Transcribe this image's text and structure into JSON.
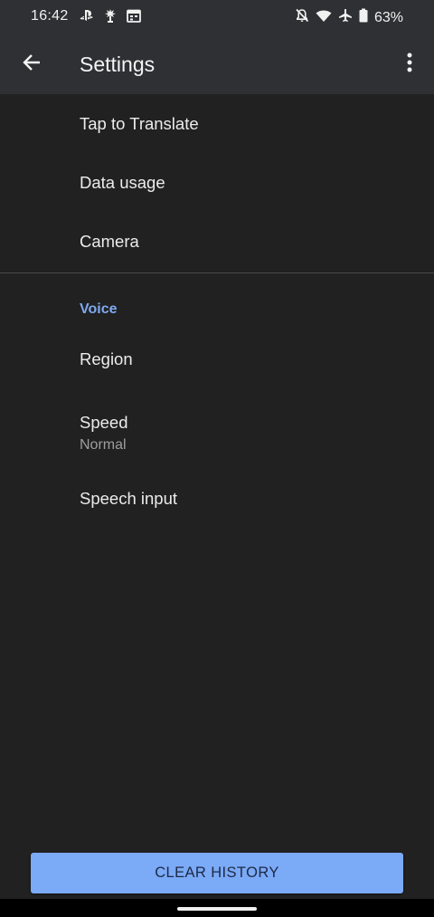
{
  "status_bar": {
    "time": "16:42",
    "battery": "63%",
    "left_icons": [
      "playstation-icon",
      "sprinkler-icon",
      "calendar-icon"
    ],
    "right_icons": [
      "notifications-off-icon",
      "wifi-icon",
      "airplane-icon",
      "battery-icon"
    ]
  },
  "app_bar": {
    "title": "Settings",
    "back_icon": "arrow-back-icon",
    "more_icon": "more-vert-icon"
  },
  "settings": {
    "items": [
      {
        "label": "Tap to Translate"
      },
      {
        "label": "Data usage"
      },
      {
        "label": "Camera"
      }
    ],
    "voice_section": {
      "header": "Voice",
      "region": {
        "label": "Region"
      },
      "speed": {
        "label": "Speed",
        "value": "Normal"
      },
      "speech_input": {
        "label": "Speech input"
      }
    }
  },
  "footer": {
    "clear_history_label": "CLEAR HISTORY"
  },
  "colors": {
    "background": "#212121",
    "app_bar": "#2f3033",
    "accent": "#7baaf7",
    "section_header": "#7fa9f0"
  }
}
